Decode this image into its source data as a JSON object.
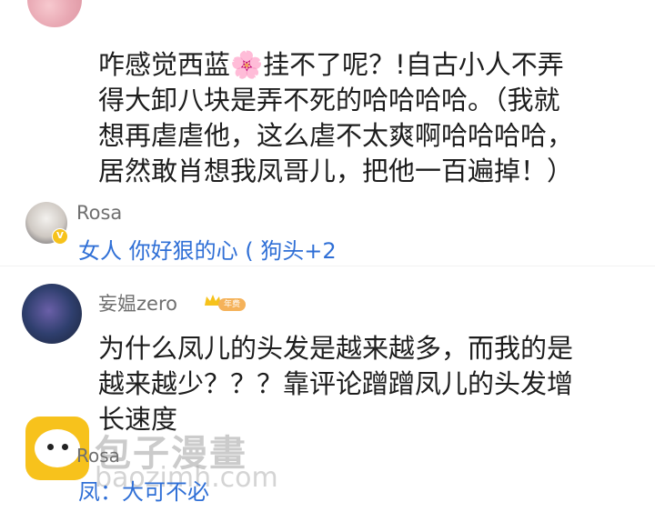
{
  "comments": [
    {
      "text_lines": [
        "咋感觉西蓝🌸挂不了呢？!自古小人不弄",
        "得大卸八块是弄不死的哈哈哈哈。（我就",
        "想再虐虐他，这么虐不太爽啊哈哈哈哈，",
        "居然敢肖想我凤哥儿，把他一百遍掉！）"
      ],
      "reply": {
        "author": "Rosa",
        "text": "女人 你好狠的心 ( 狗头+2"
      }
    },
    {
      "author": "妄媪zero",
      "badge": "年费",
      "text_lines": [
        "为什么凤儿的头发是越来越多，而我的是",
        "越来越少？？？靠评论蹭蹭凤儿的头发增",
        "长速度"
      ],
      "reply": {
        "author": "Rosa",
        "text": "凤：大可不必"
      }
    }
  ],
  "watermark": {
    "title": "包子漫畫",
    "url": "baozimh.com"
  },
  "colors": {
    "reply_link": "#2f6fd6",
    "badge": "#f5b25a",
    "vip": "#f6c21b"
  }
}
